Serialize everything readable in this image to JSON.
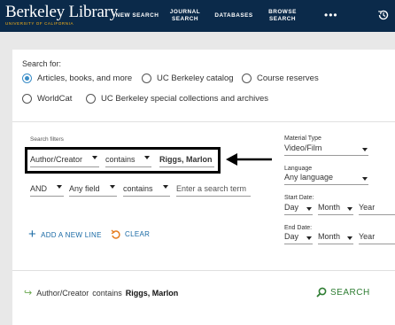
{
  "header": {
    "logo_main": "Berkeley Library",
    "logo_sub": "UNIVERSITY OF CALIFORNIA",
    "nav": [
      {
        "lines": [
          "NEW SEARCH"
        ]
      },
      {
        "lines": [
          "JOURNAL",
          "SEARCH"
        ]
      },
      {
        "lines": [
          "DATABASES"
        ]
      },
      {
        "lines": [
          "BROWSE",
          "SEARCH"
        ]
      }
    ],
    "more": "•••"
  },
  "search_for": {
    "label": "Search for:",
    "options": [
      {
        "label": "Articles, books, and more",
        "selected": true
      },
      {
        "label": "UC Berkeley catalog",
        "selected": false
      },
      {
        "label": "Course reserves",
        "selected": false
      },
      {
        "label": "WorldCat",
        "selected": false
      },
      {
        "label": "UC Berkeley special collections and archives",
        "selected": false
      }
    ]
  },
  "filters": {
    "label": "Search filters",
    "row1": {
      "field": "Author/Creator",
      "op": "contains",
      "value": "Riggs, Marlon"
    },
    "row2": {
      "bool": "AND",
      "field": "Any field",
      "op": "contains",
      "placeholder": "Enter a search term"
    },
    "add_line": "ADD A NEW LINE",
    "clear": "CLEAR"
  },
  "side": {
    "material_label": "Material Type",
    "material_value": "Video/Film",
    "language_label": "Language",
    "language_value": "Any language",
    "start_label": "Start Date:",
    "end_label": "End Date:",
    "day": "Day",
    "month": "Month",
    "year": "Year"
  },
  "summary": {
    "field": "Author/Creator",
    "op": "contains",
    "value": "Riggs, Marlon",
    "search_label": "SEARCH"
  },
  "colors": {
    "header_bg": "#0b2a4a",
    "accent_blue": "#3a8dc7",
    "search_green": "#2e7d32"
  }
}
